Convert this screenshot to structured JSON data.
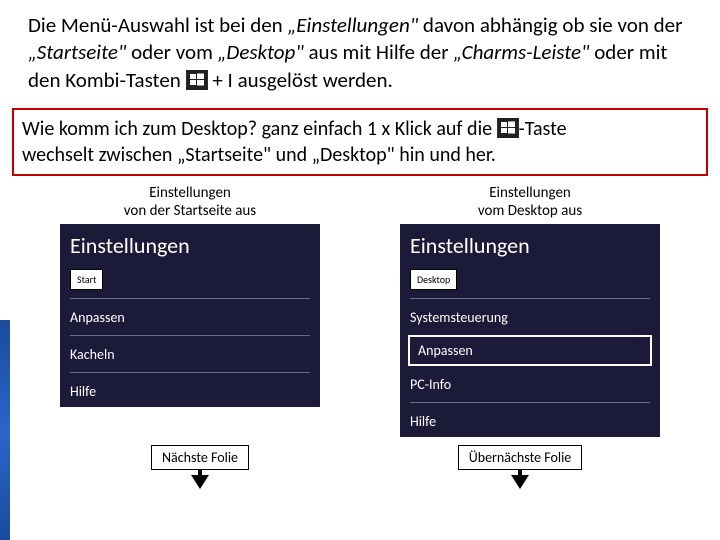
{
  "paragraph": {
    "pre1": "Die Menü-Auswahl ist bei den ",
    "q1": "„Einstellungen\"",
    "mid1": " davon abhängig ob sie von der ",
    "q2": "„Startseite\"",
    "mid2": " oder vom ",
    "q3": "„Desktop\"",
    "mid3": " aus mit Hilfe der ",
    "q4": "„Charms-Leiste\"",
    "mid4": " oder mit den Kombi-Tasten ",
    "tail": " + I ausgelöst werden."
  },
  "redbox": {
    "line1a": "Wie komm ich zum Desktop? ganz einfach 1 x Klick auf die ",
    "line1b": "-Taste",
    "line2a": "wechselt zwischen ",
    "q1": "„Startseite\"",
    "line2b": " und ",
    "q2": "„Desktop\"",
    "line2c": " hin und her."
  },
  "left": {
    "title_l1": "Einstellungen",
    "title_l2": "von der Startseite aus",
    "panel_header": "Einstellungen",
    "sub_box": "Start",
    "items": [
      "Anpassen",
      "Kacheln",
      "Hilfe"
    ],
    "footer": "Nächste Folie"
  },
  "right": {
    "title_l1": "Einstellungen",
    "title_l2": "vom Desktop aus",
    "panel_header": "Einstellungen",
    "sub_box": "Desktop",
    "items": [
      "Systemsteuerung",
      "Anpassen",
      "PC-Info",
      "Hilfe"
    ],
    "footer": "Übernächste Folie"
  }
}
